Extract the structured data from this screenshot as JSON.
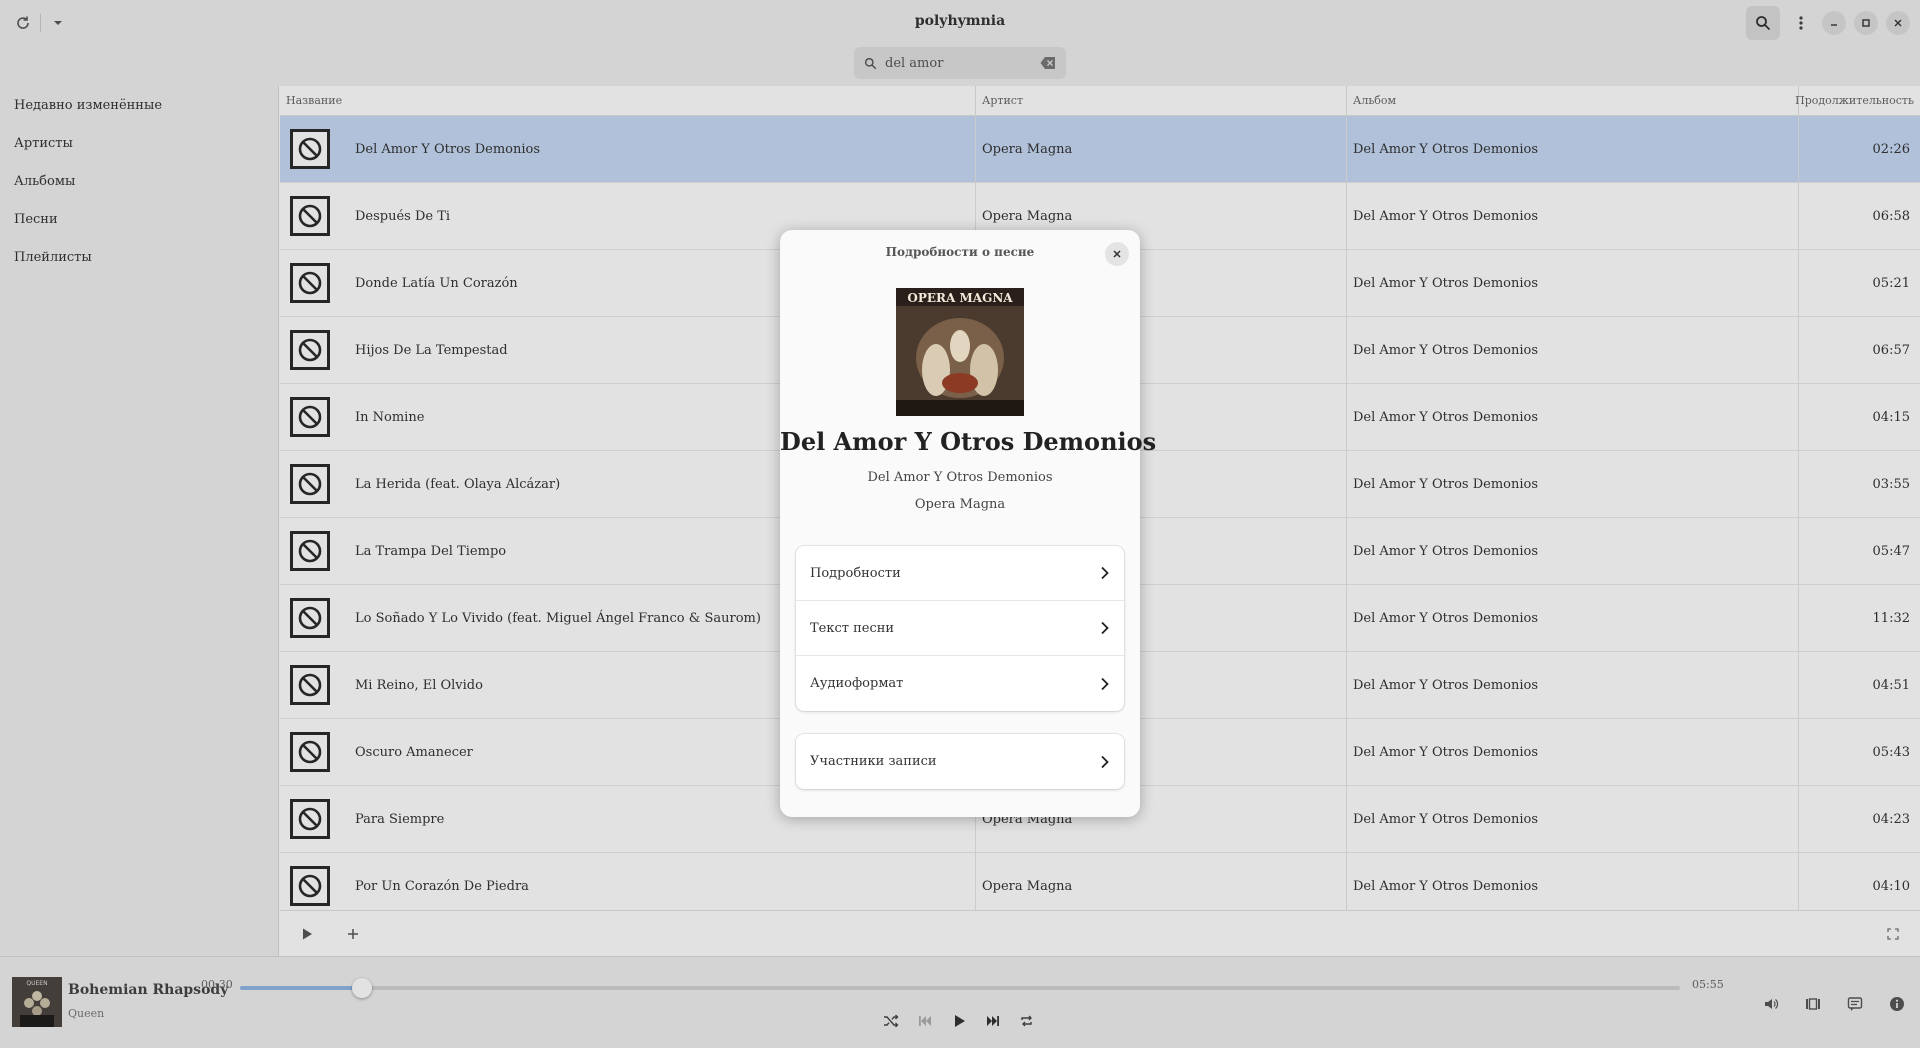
{
  "app": {
    "title": "polyhymnia",
    "search_value": "del amor",
    "icons": [
      "refresh-icon",
      "chevron-down-icon",
      "search-icon",
      "menu-icon",
      "minimize-icon",
      "maximize-icon",
      "close-icon"
    ]
  },
  "sidebar": {
    "items": [
      {
        "label": "Недавно изменённые"
      },
      {
        "label": "Артисты"
      },
      {
        "label": "Альбомы"
      },
      {
        "label": "Песни"
      },
      {
        "label": "Плейлисты"
      }
    ]
  },
  "table": {
    "columns": {
      "name": "Название",
      "artist": "Артист",
      "album": "Альбом",
      "duration": "Продолжительность"
    },
    "rows": [
      {
        "title": "Del Amor Y Otros Demonios",
        "artist": "Opera Magna",
        "album": "Del Amor Y Otros Demonios",
        "duration": "02:26",
        "selected": true
      },
      {
        "title": "Después De Ti",
        "artist": "Opera Magna",
        "album": "Del Amor Y Otros Demonios",
        "duration": "06:58"
      },
      {
        "title": "Donde Latía Un Corazón",
        "artist": "",
        "album": "Del Amor Y Otros Demonios",
        "duration": "05:21"
      },
      {
        "title": "Hijos De La Tempestad",
        "artist": "",
        "album": "Del Amor Y Otros Demonios",
        "duration": "06:57"
      },
      {
        "title": "In Nomine",
        "artist": "",
        "album": "Del Amor Y Otros Demonios",
        "duration": "04:15"
      },
      {
        "title": "La Herida (feat. Olaya Alcázar)",
        "artist": "",
        "album": "Del Amor Y Otros Demonios",
        "duration": "03:55"
      },
      {
        "title": "La Trampa Del Tiempo",
        "artist": "",
        "album": "Del Amor Y Otros Demonios",
        "duration": "05:47"
      },
      {
        "title": "Lo Soñado Y Lo Vivido (feat. Miguel Ángel Franco & Saurom)",
        "artist": "",
        "album": "Del Amor Y Otros Demonios",
        "duration": "11:32"
      },
      {
        "title": "Mi Reino, El Olvido",
        "artist": "",
        "album": "Del Amor Y Otros Demonios",
        "duration": "04:51"
      },
      {
        "title": "Oscuro Amanecer",
        "artist": "",
        "album": "Del Amor Y Otros Demonios",
        "duration": "05:43"
      },
      {
        "title": "Para Siempre",
        "artist": "Opera Magna",
        "album": "Del Amor Y Otros Demonios",
        "duration": "04:23"
      },
      {
        "title": "Por Un Corazón De Piedra",
        "artist": "Opera Magna",
        "album": "Del Amor Y Otros Demonios",
        "duration": "04:10"
      }
    ]
  },
  "player": {
    "title": "Bohemian Rhapsody",
    "artist": "Queen",
    "cover_text": "QUEEN",
    "elapsed": "00:30",
    "total": "05:55",
    "progress": 0.0845
  },
  "dialog": {
    "title": "Подробности о песне",
    "cover_text": "OPERA MAGNA",
    "song_title": "Del Amor Y Otros Demonios",
    "album": "Del Amor Y Otros Demonios",
    "artist": "Opera Magna",
    "group1": [
      {
        "label": "Подробности"
      },
      {
        "label": "Текст песни"
      },
      {
        "label": "Аудиоформат"
      }
    ],
    "group2": [
      {
        "label": "Участники записи"
      }
    ]
  },
  "colors": {
    "accent_selected_row": "#c3d6f0",
    "progress_fill": "#8fb3e0"
  }
}
